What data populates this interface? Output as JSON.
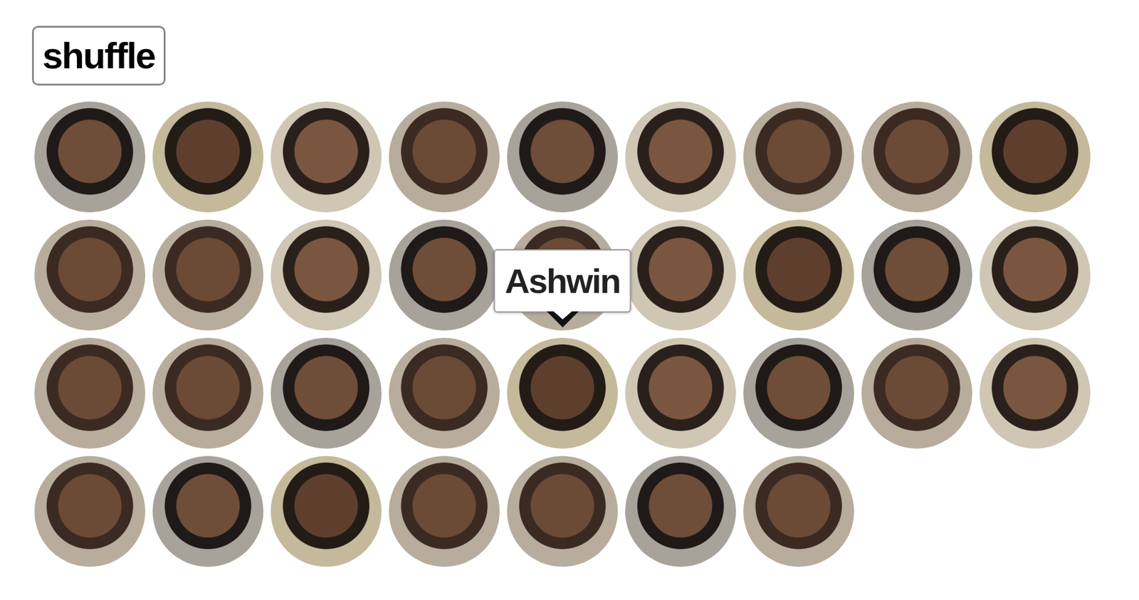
{
  "button": {
    "label": "shuffle"
  },
  "tooltip": {
    "text": "Ashwin"
  },
  "photos": [
    {
      "hovered": false
    },
    {
      "hovered": false
    },
    {
      "hovered": false
    },
    {
      "hovered": false
    },
    {
      "hovered": false
    },
    {
      "hovered": false
    },
    {
      "hovered": false
    },
    {
      "hovered": false
    },
    {
      "hovered": false
    },
    {
      "hovered": false
    },
    {
      "hovered": false
    },
    {
      "hovered": false
    },
    {
      "hovered": false
    },
    {
      "hovered": false
    },
    {
      "hovered": false
    },
    {
      "hovered": false
    },
    {
      "hovered": false
    },
    {
      "hovered": false
    },
    {
      "hovered": false
    },
    {
      "hovered": false
    },
    {
      "hovered": false
    },
    {
      "hovered": false
    },
    {
      "hovered": true
    },
    {
      "hovered": false
    },
    {
      "hovered": false
    },
    {
      "hovered": false
    },
    {
      "hovered": false
    },
    {
      "hovered": false
    },
    {
      "hovered": false
    },
    {
      "hovered": false
    },
    {
      "hovered": false
    },
    {
      "hovered": false
    },
    {
      "hovered": false
    },
    {
      "hovered": false
    }
  ]
}
